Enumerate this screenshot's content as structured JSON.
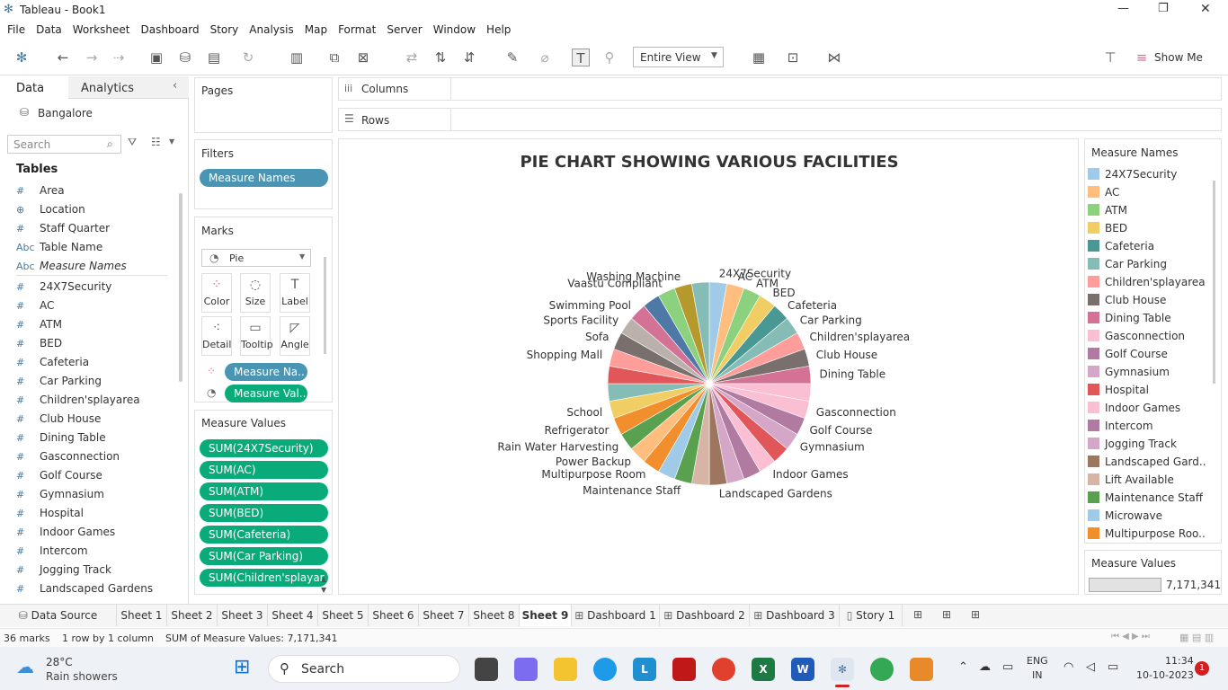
{
  "window": {
    "title": "Tableau - Book1",
    "controls": [
      "—",
      "❐",
      "✕"
    ]
  },
  "menu": [
    "File",
    "Data",
    "Worksheet",
    "Dashboard",
    "Story",
    "Analysis",
    "Map",
    "Format",
    "Server",
    "Window",
    "Help"
  ],
  "toolbar": {
    "view_select": "Entire View",
    "show_me": "Show Me"
  },
  "datapane": {
    "tab_data": "Data",
    "tab_analytics": "Analytics",
    "datasource": "Bangalore",
    "search_placeholder": "Search",
    "tables_title": "Tables",
    "fields": [
      {
        "icon": "#",
        "name": "Area"
      },
      {
        "icon": "⊕",
        "name": "Location"
      },
      {
        "icon": "#",
        "name": "Staff Quarter"
      },
      {
        "icon": "Abc",
        "name": "Table Name"
      },
      {
        "icon": "Abc",
        "name": "Measure Names"
      },
      {
        "icon": "#",
        "name": "24X7Security"
      },
      {
        "icon": "#",
        "name": "AC"
      },
      {
        "icon": "#",
        "name": "ATM"
      },
      {
        "icon": "#",
        "name": "BED"
      },
      {
        "icon": "#",
        "name": "Cafeteria"
      },
      {
        "icon": "#",
        "name": "Car Parking"
      },
      {
        "icon": "#",
        "name": "Children'splayarea"
      },
      {
        "icon": "#",
        "name": "Club House"
      },
      {
        "icon": "#",
        "name": "Dining Table"
      },
      {
        "icon": "#",
        "name": "Gasconnection"
      },
      {
        "icon": "#",
        "name": "Golf Course"
      },
      {
        "icon": "#",
        "name": "Gymnasium"
      },
      {
        "icon": "#",
        "name": "Hospital"
      },
      {
        "icon": "#",
        "name": "Indoor Games"
      },
      {
        "icon": "#",
        "name": "Intercom"
      },
      {
        "icon": "#",
        "name": "Jogging Track"
      },
      {
        "icon": "#",
        "name": "Landscaped Gardens"
      }
    ]
  },
  "cards": {
    "pages": "Pages",
    "filters": "Filters",
    "filter_pill": "Measure Names",
    "marks": "Marks",
    "mark_type": "Pie",
    "mark_buttons": [
      "Color",
      "Size",
      "Label",
      "Detail",
      "Tooltip",
      "Angle"
    ],
    "mark_pills": [
      "Measure Na..",
      "Measure Val.."
    ],
    "measure_values": "Measure Values",
    "mv_pills": [
      "SUM(24X7Security)",
      "SUM(AC)",
      "SUM(ATM)",
      "SUM(BED)",
      "SUM(Cafeteria)",
      "SUM(Car Parking)",
      "SUM(Children'splayar.."
    ]
  },
  "shelves": {
    "columns": "Columns",
    "rows": "Rows"
  },
  "chart_data": {
    "type": "pie",
    "title": "PIE CHART SHOWING VARIOUS FACILITIES",
    "slices": [
      {
        "label": "24X7Security",
        "value": 1,
        "color": "#a0cbe8"
      },
      {
        "label": "AC",
        "value": 1,
        "color": "#ffbe7d"
      },
      {
        "label": "ATM",
        "value": 1,
        "color": "#8cd17d"
      },
      {
        "label": "BED",
        "value": 1,
        "color": "#f1ce63"
      },
      {
        "label": "Cafeteria",
        "value": 1,
        "color": "#499894"
      },
      {
        "label": "Car Parking",
        "value": 1,
        "color": "#86bcb6"
      },
      {
        "label": "Children'splayarea",
        "value": 1,
        "color": "#ff9d9a"
      },
      {
        "label": "Club House",
        "value": 1,
        "color": "#79706e"
      },
      {
        "label": "Dining Table",
        "value": 1,
        "color": "#d37295"
      },
      {
        "label": "",
        "value": 1,
        "color": "#fabfd2"
      },
      {
        "label": "Gasconnection",
        "value": 1,
        "color": "#fabfd2"
      },
      {
        "label": "Golf Course",
        "value": 1,
        "color": "#b07aa1"
      },
      {
        "label": "Gymnasium",
        "value": 1,
        "color": "#d4a6c8"
      },
      {
        "label": "",
        "value": 1,
        "color": "#e15759"
      },
      {
        "label": "Indoor Games",
        "value": 1,
        "color": "#fabfd2"
      },
      {
        "label": "",
        "value": 1,
        "color": "#b07aa1"
      },
      {
        "label": "",
        "value": 1,
        "color": "#d4a6c8"
      },
      {
        "label": "Landscaped Gardens",
        "value": 1,
        "color": "#9d7660"
      },
      {
        "label": "",
        "value": 1,
        "color": "#d7b5a6"
      },
      {
        "label": "Maintenance Staff",
        "value": 1,
        "color": "#59a14f"
      },
      {
        "label": "",
        "value": 1,
        "color": "#a0cbe8"
      },
      {
        "label": "Multipurpose Room",
        "value": 1,
        "color": "#f28e2b"
      },
      {
        "label": "Power Backup",
        "value": 1,
        "color": "#ffbe7d"
      },
      {
        "label": "Rain Water Harvesting",
        "value": 1,
        "color": "#59a14f"
      },
      {
        "label": "Refrigerator",
        "value": 1,
        "color": "#f28e2b"
      },
      {
        "label": "School",
        "value": 1,
        "color": "#f1ce63"
      },
      {
        "label": "",
        "value": 1,
        "color": "#86bcb6"
      },
      {
        "label": "",
        "value": 1,
        "color": "#e15759"
      },
      {
        "label": "Shopping Mall",
        "value": 1,
        "color": "#ff9d9a"
      },
      {
        "label": "Sofa",
        "value": 1,
        "color": "#79706e"
      },
      {
        "label": "Sports Facility",
        "value": 1,
        "color": "#bab0ac"
      },
      {
        "label": "Swimming Pool",
        "value": 1,
        "color": "#d37295"
      },
      {
        "label": "",
        "value": 1,
        "color": "#4e79a7"
      },
      {
        "label": "Vaastu Compliant",
        "value": 1,
        "color": "#8cd17d"
      },
      {
        "label": "Washing Machine",
        "value": 1,
        "color": "#b6992d"
      },
      {
        "label": "",
        "value": 1,
        "color": "#86bcb6"
      }
    ]
  },
  "legend": {
    "title": "Measure Names",
    "items": [
      {
        "label": "24X7Security",
        "color": "#a0cbe8"
      },
      {
        "label": "AC",
        "color": "#ffbe7d"
      },
      {
        "label": "ATM",
        "color": "#8cd17d"
      },
      {
        "label": "BED",
        "color": "#f1ce63"
      },
      {
        "label": "Cafeteria",
        "color": "#499894"
      },
      {
        "label": "Car Parking",
        "color": "#86bcb6"
      },
      {
        "label": "Children'splayarea",
        "color": "#ff9d9a"
      },
      {
        "label": "Club House",
        "color": "#79706e"
      },
      {
        "label": "Dining Table",
        "color": "#d37295"
      },
      {
        "label": "Gasconnection",
        "color": "#fabfd2"
      },
      {
        "label": "Golf Course",
        "color": "#b07aa1"
      },
      {
        "label": "Gymnasium",
        "color": "#d4a6c8"
      },
      {
        "label": "Hospital",
        "color": "#e15759"
      },
      {
        "label": "Indoor Games",
        "color": "#fabfd2"
      },
      {
        "label": "Intercom",
        "color": "#b07aa1"
      },
      {
        "label": "Jogging Track",
        "color": "#d4a6c8"
      },
      {
        "label": "Landscaped Gard..",
        "color": "#9d7660"
      },
      {
        "label": "Lift Available",
        "color": "#d7b5a6"
      },
      {
        "label": "Maintenance Staff",
        "color": "#59a14f"
      },
      {
        "label": "Microwave",
        "color": "#a0cbe8"
      },
      {
        "label": "Multipurpose Roo..",
        "color": "#f28e2b"
      }
    ],
    "mv_title": "Measure Values",
    "mv_value": "7,171,341"
  },
  "tabs": [
    "Data Source",
    "Sheet 1",
    "Sheet 2",
    "Sheet 3",
    "Sheet 4",
    "Sheet 5",
    "Sheet 6",
    "Sheet 7",
    "Sheet 8",
    "Sheet 9",
    "Dashboard 1",
    "Dashboard 2",
    "Dashboard 3",
    "Story 1"
  ],
  "status": {
    "marks": "36 marks",
    "rows": "1 row by 1 column",
    "sum": "SUM of Measure Values: 7,171,341"
  },
  "taskbar": {
    "weather_temp": "28°C",
    "weather_desc": "Rain showers",
    "search": "Search",
    "lang1": "ENG",
    "lang2": "IN",
    "time": "11:34",
    "date": "10-10-2023",
    "notif": "1"
  }
}
